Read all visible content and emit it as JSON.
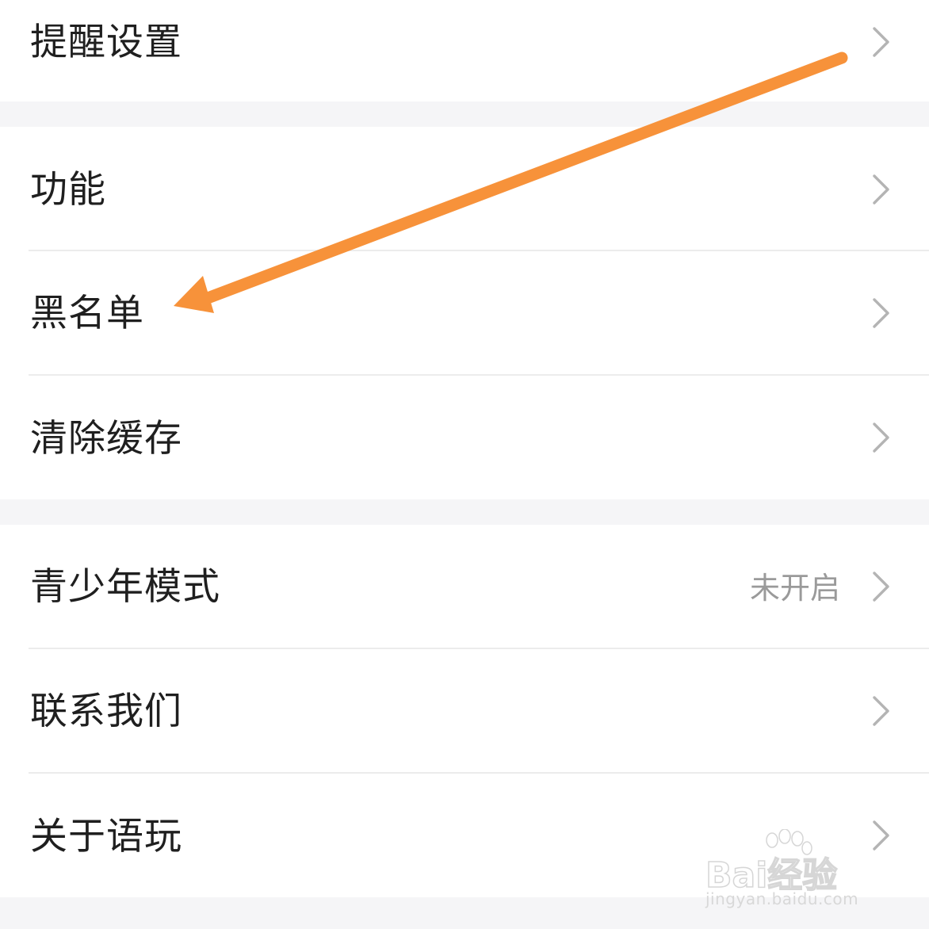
{
  "settings": {
    "reminder": {
      "label": "提醒设置"
    },
    "features": {
      "label": "功能"
    },
    "blacklist": {
      "label": "黑名单"
    },
    "clear_cache": {
      "label": "清除缓存"
    },
    "teen_mode": {
      "label": "青少年模式",
      "value": "未开启"
    },
    "contact_us": {
      "label": "联系我们"
    },
    "about": {
      "label": "关于语玩"
    }
  },
  "annotation": {
    "arrow_color": "#f7923a",
    "points_to": "blacklist"
  },
  "watermark": {
    "brand": "Bai经验",
    "url": "jingyan.baidu.com"
  },
  "icons": {
    "chevron": "chevron-right-icon",
    "arrow": "arrow-annotation-icon",
    "watermark": "paw-icon"
  },
  "colors": {
    "text": "#1f1f1f",
    "secondary_text": "#9a9a9a",
    "chevron": "#b4b4b4",
    "divider": "#ececec",
    "section_gap": "#f5f5f7",
    "background": "#ffffff"
  }
}
